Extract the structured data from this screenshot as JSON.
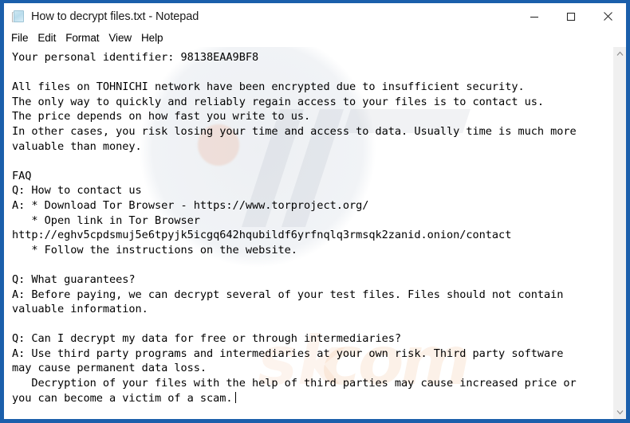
{
  "window": {
    "title": "How to decrypt files.txt - Notepad",
    "icon": "notepad-document-icon",
    "frame_color": "#1b5fab",
    "background_color": "#ffffff",
    "controls": {
      "minimize": "–",
      "maximize": "□",
      "close": "✕"
    }
  },
  "menubar": {
    "items": [
      {
        "label": "File"
      },
      {
        "label": "Edit"
      },
      {
        "label": "Format"
      },
      {
        "label": "View"
      },
      {
        "label": "Help"
      }
    ]
  },
  "document": {
    "personal_identifier": "98138EAA9BF8",
    "victim_network": "TOHNICHI",
    "tor_browser_url": "https://www.torproject.org/",
    "onion_contact_url": "http://eghv5cpdsmuj5e6tpyjk5icgq642hqubildf6yrfnqlq3rmsqk2zanid.onion/contact",
    "lines": [
      "Your personal identifier: 98138EAA9BF8",
      "",
      "All files on TOHNICHI network have been encrypted due to insufficient security.",
      "The only way to quickly and reliably regain access to your files is to contact us.",
      "The price depends on how fast you write to us.",
      "In other cases, you risk losing your time and access to data. Usually time is much more",
      "valuable than money.",
      "",
      "FAQ",
      "Q: How to contact us",
      "A: * Download Tor Browser - https://www.torproject.org/",
      "   * Open link in Tor Browser",
      "http://eghv5cpdsmuj5e6tpyjk5icgq642hqubildf6yrfnqlq3rmsqk2zanid.onion/contact",
      "   * Follow the instructions on the website.",
      "",
      "Q: What guarantees?",
      "A: Before paying, we can decrypt several of your test files. Files should not contain",
      "valuable information.",
      "",
      "Q: Can I decrypt my data for free or through intermediaries?",
      "A: Use third party programs and intermediaries at your own risk. Third party software",
      "may cause permanent data loss.",
      "   Decryption of your files with the help of third parties may cause increased price or",
      "you can become a victim of a scam."
    ],
    "caret_visible": true
  },
  "scrollbar": {
    "up_arrow": "∧",
    "down_arrow": "∨",
    "position": "top"
  }
}
